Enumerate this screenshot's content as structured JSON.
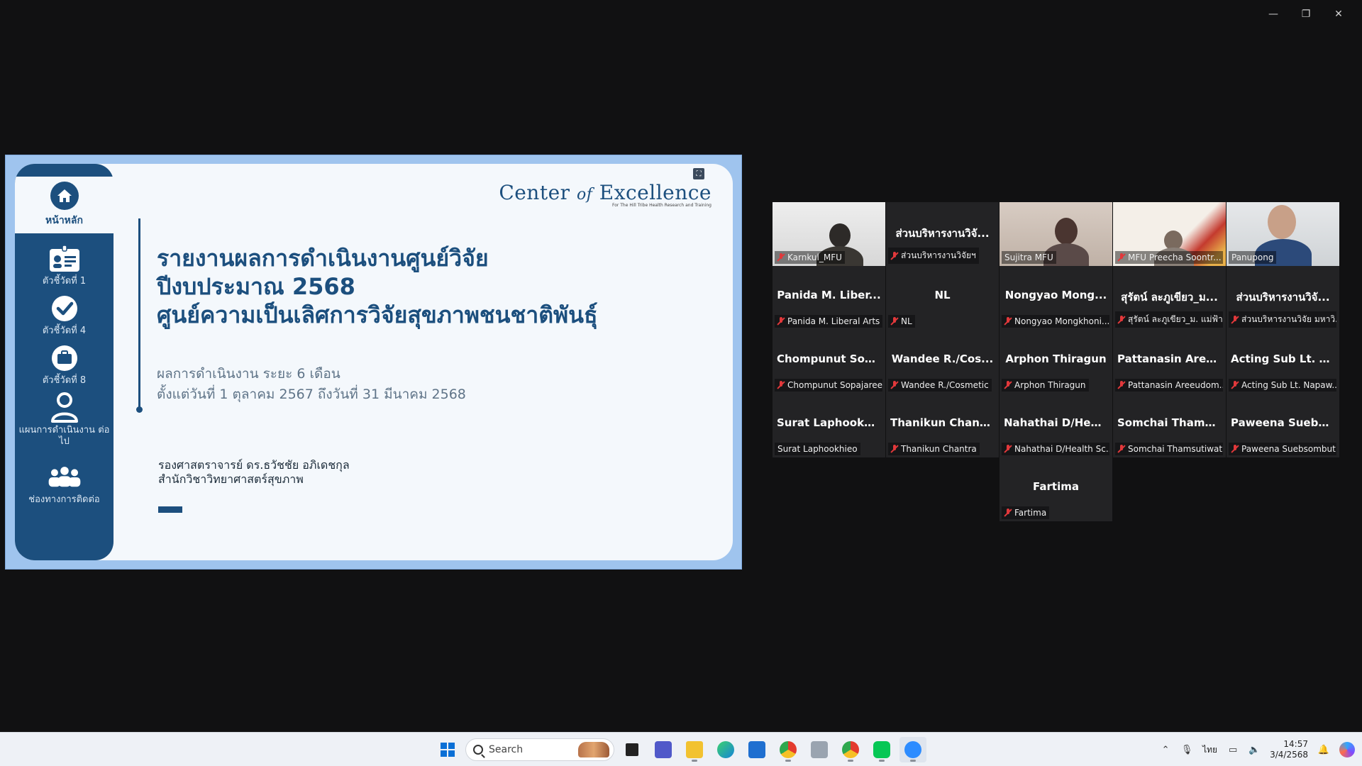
{
  "window": {
    "minimize": "—",
    "restore": "❐",
    "close": "✕"
  },
  "slide": {
    "fullscreen_icon": "⛶",
    "sidebar": {
      "home": "หน้าหลัก",
      "items": [
        {
          "label": "ตัวชี้วัดที่ 1",
          "icon": "id-card-icon"
        },
        {
          "label": "ตัวชี้วัดที่ 4",
          "icon": "check-circle-icon"
        },
        {
          "label": "ตัวชี้วัดที่ 8",
          "icon": "briefcase-icon"
        },
        {
          "label": "แผนการดำเนินงาน ต่อไป",
          "icon": "person-icon"
        },
        {
          "label": "ช่องทางการติดต่อ",
          "icon": "group-icon"
        }
      ]
    },
    "logo": {
      "title_a": "Center",
      "title_of": "of",
      "title_b": "Excellence",
      "subtitle": "For The Hill Tribe Health Research and Training"
    },
    "title": [
      "รายงานผลการดำเนินงานศูนย์วิจัย",
      "ปีงบประมาณ 2568",
      "ศูนย์ความเป็นเลิศการวิจัยสุขภาพชนชาติพันธุ์"
    ],
    "period": [
      "ผลการดำเนินงาน ระยะ 6 เดือน",
      "ตั้งแต่วันที่ 1 ตุลาคม 2567 ถึงวันที่ 31 มีนาคม 2568"
    ],
    "presenter": [
      "รองศาสตราจารย์ ดร.ธวัชชัย อภิเดชกุล",
      "สำนักวิชาวิทยาศาสตร์สุขภาพ"
    ]
  },
  "gallery": {
    "tiles": [
      {
        "name": "",
        "caption": "Karnkul_MFU",
        "video": true,
        "muted": true
      },
      {
        "name": "ส่วนบริหารงานวิจั...",
        "caption": "ส่วนบริหารงานวิจัยฯ",
        "video": false,
        "muted": true
      },
      {
        "name": "",
        "caption": "Sujitra MFU",
        "video": true,
        "muted": false
      },
      {
        "name": "",
        "caption": "MFU Preecha Soontr...",
        "video": true,
        "muted": true
      },
      {
        "name": "",
        "caption": "Panupong",
        "video": true,
        "muted": false,
        "active": true
      },
      {
        "name": "Panida M. Liber...",
        "caption": "Panida M. Liberal Arts",
        "muted": true
      },
      {
        "name": "NL",
        "caption": "NL",
        "muted": true
      },
      {
        "name": "Nongyao Mong...",
        "caption": "Nongyao Mongkhoni...",
        "muted": true
      },
      {
        "name": "สุรัตน์ ละภูเขียว_ม...",
        "caption": "สุรัตน์ ละภูเขียว_ม. แม่ฟ้า...",
        "muted": true
      },
      {
        "name": "ส่วนบริหารงานวิจั...",
        "caption": "ส่วนบริหารงานวิจัย มหาวิ...",
        "muted": true
      },
      {
        "name": "Chompunut Sop...",
        "caption": "Chompunut Sopajaree",
        "muted": true
      },
      {
        "name": "Wandee R./Cos...",
        "caption": "Wandee R./Cosmetic",
        "muted": true
      },
      {
        "name": "Arphon Thiragun",
        "caption": "Arphon Thiragun",
        "muted": true
      },
      {
        "name": "Pattanasin Aree...",
        "caption": "Pattanasin Areeudom...",
        "muted": true
      },
      {
        "name": "Acting Sub Lt. N...",
        "caption": "Acting Sub Lt. Napaw...",
        "muted": true
      },
      {
        "name": "Surat Laphookhi...",
        "caption": "Surat Laphookhieo",
        "muted": false
      },
      {
        "name": "Thanikun Chantra",
        "caption": "Thanikun Chantra",
        "muted": true
      },
      {
        "name": "Nahathai D/Hea...",
        "caption": "Nahathai D/Health Sc...",
        "muted": true
      },
      {
        "name": "Somchai Thams...",
        "caption": "Somchai Thamsutiwat",
        "muted": true
      },
      {
        "name": "Paweena Suebs...",
        "caption": "Paweena Suebsombut",
        "muted": true
      },
      {
        "name": "Fartima",
        "caption": "Fartima",
        "muted": true
      }
    ]
  },
  "taskbar": {
    "search_placeholder": "Search",
    "clock_time": "14:57",
    "clock_date": "3/4/2568",
    "language": "ไทย"
  }
}
